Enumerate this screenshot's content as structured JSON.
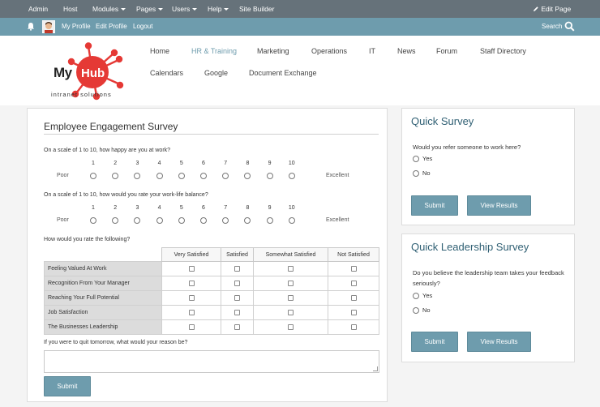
{
  "admin_bar": {
    "items": [
      "Admin",
      "Host",
      "Modules",
      "Pages",
      "Users",
      "Help",
      "Site Builder"
    ],
    "edit_page": "Edit Page"
  },
  "user_bar": {
    "my_profile": "My Profile",
    "edit_profile": "Edit Profile",
    "logout": "Logout",
    "search": "Search"
  },
  "logo": {
    "name_my": "My",
    "name_hub": "Hub",
    "tagline": "intranet solutions"
  },
  "nav": {
    "row1": [
      "Home",
      "HR & Training",
      "Marketing",
      "Operations",
      "IT",
      "News",
      "Forum",
      "Staff Directory"
    ],
    "row2": [
      "Calendars",
      "Google",
      "Document Exchange"
    ],
    "active": "HR & Training"
  },
  "survey": {
    "title": "Employee Engagement Survey",
    "q1": "On a scale of 1 to 10, how happy are you at work?",
    "q2": "On a scale of 1 to 10, how would you rate your work-life balance?",
    "scale": [
      "1",
      "2",
      "3",
      "4",
      "5",
      "6",
      "7",
      "8",
      "9",
      "10"
    ],
    "low_label": "Poor",
    "high_label": "Excellent",
    "q3": "How would you rate the following?",
    "columns": [
      "Very Satisfied",
      "Satisfied",
      "Somewhat Satisfied",
      "Not Satisfied"
    ],
    "rows": [
      "Feeling Valued At Work",
      "Recognition From Your Manager",
      "Reaching Your Full Potential",
      "Job Satisfaction",
      "The Businesses Leadership"
    ],
    "q4": "If you were to quit tomorrow, what would your reason be?",
    "submit": "Submit"
  },
  "quick_survey": {
    "title": "Quick Survey",
    "question": "Would you refer someone to work here?",
    "options": [
      "Yes",
      "No"
    ],
    "submit": "Submit",
    "results": "View Results"
  },
  "leadership_survey": {
    "title": "Quick Leadership Survey",
    "question": "Do you believe the leadership team takes your feedback seriously?",
    "options": [
      "Yes",
      "No"
    ],
    "submit": "Submit",
    "results": "View Results"
  },
  "colors": {
    "admin_bar": "#66727a",
    "accent": "#6e9cad",
    "logo_red": "#e53935"
  }
}
